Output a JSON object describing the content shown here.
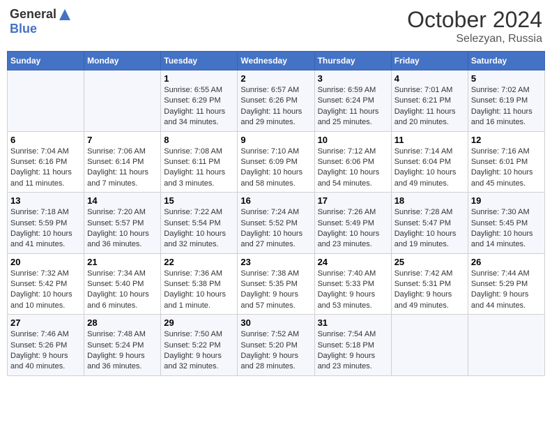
{
  "header": {
    "logo_general": "General",
    "logo_blue": "Blue",
    "month_year": "October 2024",
    "location": "Selezyan, Russia"
  },
  "days_of_week": [
    "Sunday",
    "Monday",
    "Tuesday",
    "Wednesday",
    "Thursday",
    "Friday",
    "Saturday"
  ],
  "weeks": [
    [
      {
        "day": "",
        "sunrise": "",
        "sunset": "",
        "daylight": ""
      },
      {
        "day": "",
        "sunrise": "",
        "sunset": "",
        "daylight": ""
      },
      {
        "day": "1",
        "sunrise": "Sunrise: 6:55 AM",
        "sunset": "Sunset: 6:29 PM",
        "daylight": "Daylight: 11 hours and 34 minutes."
      },
      {
        "day": "2",
        "sunrise": "Sunrise: 6:57 AM",
        "sunset": "Sunset: 6:26 PM",
        "daylight": "Daylight: 11 hours and 29 minutes."
      },
      {
        "day": "3",
        "sunrise": "Sunrise: 6:59 AM",
        "sunset": "Sunset: 6:24 PM",
        "daylight": "Daylight: 11 hours and 25 minutes."
      },
      {
        "day": "4",
        "sunrise": "Sunrise: 7:01 AM",
        "sunset": "Sunset: 6:21 PM",
        "daylight": "Daylight: 11 hours and 20 minutes."
      },
      {
        "day": "5",
        "sunrise": "Sunrise: 7:02 AM",
        "sunset": "Sunset: 6:19 PM",
        "daylight": "Daylight: 11 hours and 16 minutes."
      }
    ],
    [
      {
        "day": "6",
        "sunrise": "Sunrise: 7:04 AM",
        "sunset": "Sunset: 6:16 PM",
        "daylight": "Daylight: 11 hours and 11 minutes."
      },
      {
        "day": "7",
        "sunrise": "Sunrise: 7:06 AM",
        "sunset": "Sunset: 6:14 PM",
        "daylight": "Daylight: 11 hours and 7 minutes."
      },
      {
        "day": "8",
        "sunrise": "Sunrise: 7:08 AM",
        "sunset": "Sunset: 6:11 PM",
        "daylight": "Daylight: 11 hours and 3 minutes."
      },
      {
        "day": "9",
        "sunrise": "Sunrise: 7:10 AM",
        "sunset": "Sunset: 6:09 PM",
        "daylight": "Daylight: 10 hours and 58 minutes."
      },
      {
        "day": "10",
        "sunrise": "Sunrise: 7:12 AM",
        "sunset": "Sunset: 6:06 PM",
        "daylight": "Daylight: 10 hours and 54 minutes."
      },
      {
        "day": "11",
        "sunrise": "Sunrise: 7:14 AM",
        "sunset": "Sunset: 6:04 PM",
        "daylight": "Daylight: 10 hours and 49 minutes."
      },
      {
        "day": "12",
        "sunrise": "Sunrise: 7:16 AM",
        "sunset": "Sunset: 6:01 PM",
        "daylight": "Daylight: 10 hours and 45 minutes."
      }
    ],
    [
      {
        "day": "13",
        "sunrise": "Sunrise: 7:18 AM",
        "sunset": "Sunset: 5:59 PM",
        "daylight": "Daylight: 10 hours and 41 minutes."
      },
      {
        "day": "14",
        "sunrise": "Sunrise: 7:20 AM",
        "sunset": "Sunset: 5:57 PM",
        "daylight": "Daylight: 10 hours and 36 minutes."
      },
      {
        "day": "15",
        "sunrise": "Sunrise: 7:22 AM",
        "sunset": "Sunset: 5:54 PM",
        "daylight": "Daylight: 10 hours and 32 minutes."
      },
      {
        "day": "16",
        "sunrise": "Sunrise: 7:24 AM",
        "sunset": "Sunset: 5:52 PM",
        "daylight": "Daylight: 10 hours and 27 minutes."
      },
      {
        "day": "17",
        "sunrise": "Sunrise: 7:26 AM",
        "sunset": "Sunset: 5:49 PM",
        "daylight": "Daylight: 10 hours and 23 minutes."
      },
      {
        "day": "18",
        "sunrise": "Sunrise: 7:28 AM",
        "sunset": "Sunset: 5:47 PM",
        "daylight": "Daylight: 10 hours and 19 minutes."
      },
      {
        "day": "19",
        "sunrise": "Sunrise: 7:30 AM",
        "sunset": "Sunset: 5:45 PM",
        "daylight": "Daylight: 10 hours and 14 minutes."
      }
    ],
    [
      {
        "day": "20",
        "sunrise": "Sunrise: 7:32 AM",
        "sunset": "Sunset: 5:42 PM",
        "daylight": "Daylight: 10 hours and 10 minutes."
      },
      {
        "day": "21",
        "sunrise": "Sunrise: 7:34 AM",
        "sunset": "Sunset: 5:40 PM",
        "daylight": "Daylight: 10 hours and 6 minutes."
      },
      {
        "day": "22",
        "sunrise": "Sunrise: 7:36 AM",
        "sunset": "Sunset: 5:38 PM",
        "daylight": "Daylight: 10 hours and 1 minute."
      },
      {
        "day": "23",
        "sunrise": "Sunrise: 7:38 AM",
        "sunset": "Sunset: 5:35 PM",
        "daylight": "Daylight: 9 hours and 57 minutes."
      },
      {
        "day": "24",
        "sunrise": "Sunrise: 7:40 AM",
        "sunset": "Sunset: 5:33 PM",
        "daylight": "Daylight: 9 hours and 53 minutes."
      },
      {
        "day": "25",
        "sunrise": "Sunrise: 7:42 AM",
        "sunset": "Sunset: 5:31 PM",
        "daylight": "Daylight: 9 hours and 49 minutes."
      },
      {
        "day": "26",
        "sunrise": "Sunrise: 7:44 AM",
        "sunset": "Sunset: 5:29 PM",
        "daylight": "Daylight: 9 hours and 44 minutes."
      }
    ],
    [
      {
        "day": "27",
        "sunrise": "Sunrise: 7:46 AM",
        "sunset": "Sunset: 5:26 PM",
        "daylight": "Daylight: 9 hours and 40 minutes."
      },
      {
        "day": "28",
        "sunrise": "Sunrise: 7:48 AM",
        "sunset": "Sunset: 5:24 PM",
        "daylight": "Daylight: 9 hours and 36 minutes."
      },
      {
        "day": "29",
        "sunrise": "Sunrise: 7:50 AM",
        "sunset": "Sunset: 5:22 PM",
        "daylight": "Daylight: 9 hours and 32 minutes."
      },
      {
        "day": "30",
        "sunrise": "Sunrise: 7:52 AM",
        "sunset": "Sunset: 5:20 PM",
        "daylight": "Daylight: 9 hours and 28 minutes."
      },
      {
        "day": "31",
        "sunrise": "Sunrise: 7:54 AM",
        "sunset": "Sunset: 5:18 PM",
        "daylight": "Daylight: 9 hours and 23 minutes."
      },
      {
        "day": "",
        "sunrise": "",
        "sunset": "",
        "daylight": ""
      },
      {
        "day": "",
        "sunrise": "",
        "sunset": "",
        "daylight": ""
      }
    ]
  ]
}
